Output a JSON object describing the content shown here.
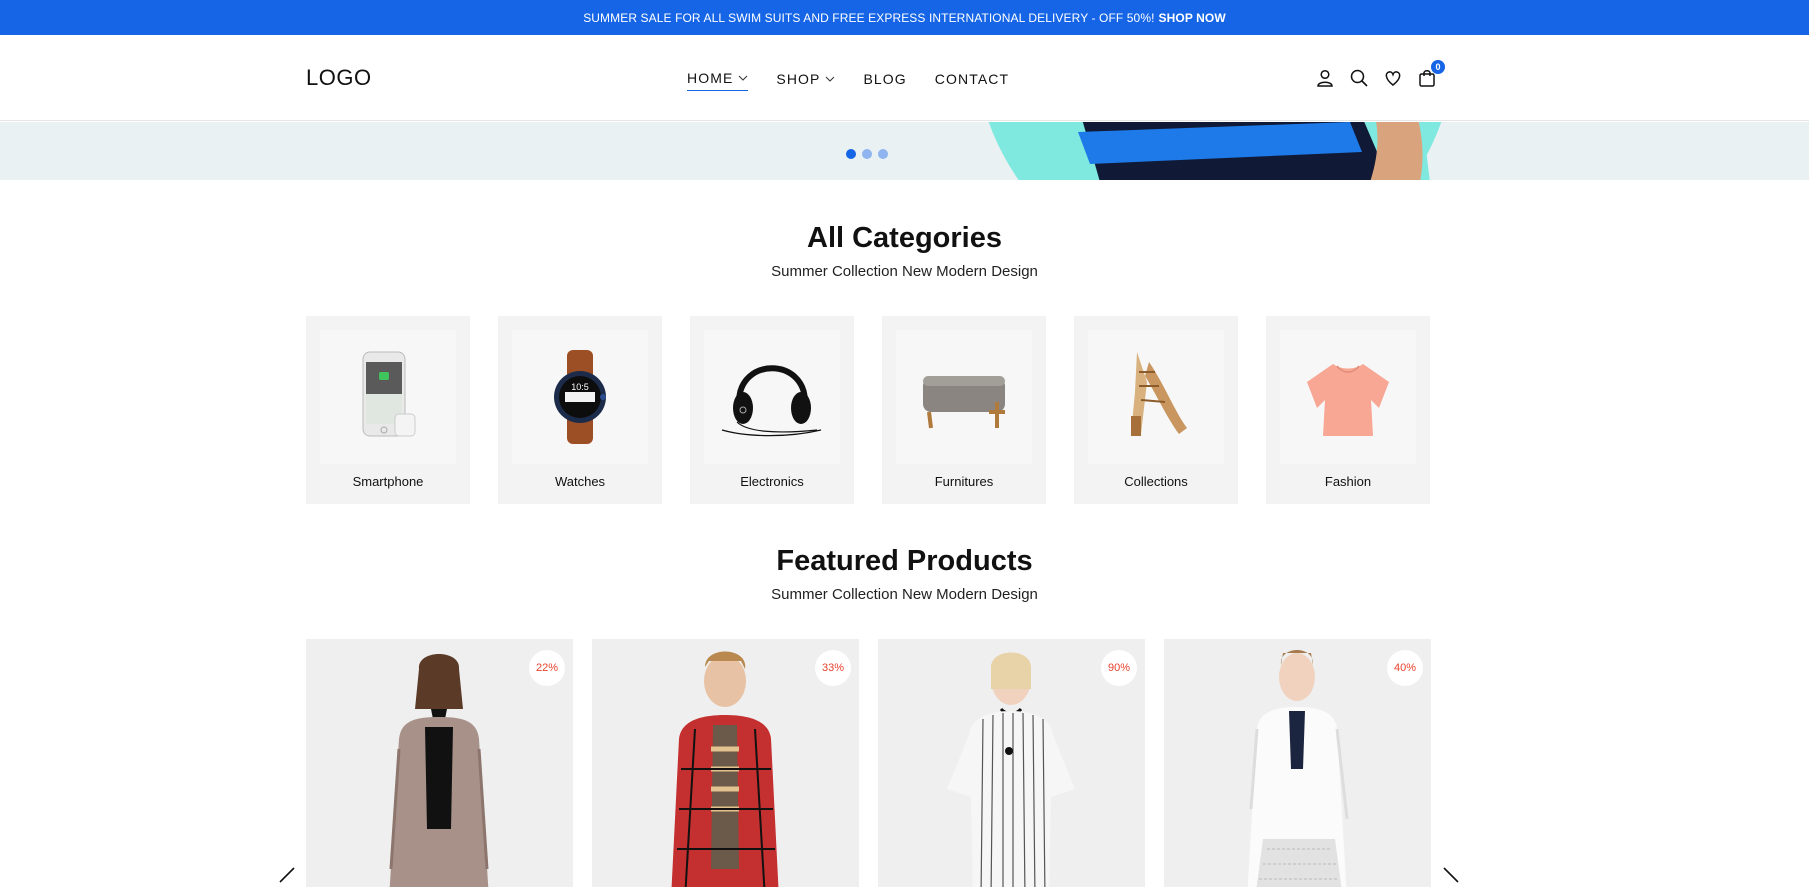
{
  "topbar": {
    "message": "SUMMER SALE FOR ALL SWIM SUITS AND FREE EXPRESS INTERNATIONAL DELIVERY - OFF 50%!",
    "cta": "SHOP NOW"
  },
  "header": {
    "logo": "LOGO",
    "nav": [
      {
        "label": "HOME",
        "active": true,
        "dropdown": true
      },
      {
        "label": "SHOP",
        "active": false,
        "dropdown": true
      },
      {
        "label": "BLOG",
        "active": false,
        "dropdown": false
      },
      {
        "label": "CONTACT",
        "active": false,
        "dropdown": false
      }
    ],
    "icons": [
      "user-icon",
      "search-icon",
      "heart-icon",
      "cart-icon"
    ],
    "cart_count": "0"
  },
  "hero": {
    "slides": 3,
    "active_slide": 1
  },
  "categories": {
    "title": "All Categories",
    "subtitle": "Summer Collection New Modern Design",
    "items": [
      {
        "label": "Smartphone",
        "icon": "smartphone-image"
      },
      {
        "label": "Watches",
        "icon": "watch-image"
      },
      {
        "label": "Electronics",
        "icon": "headphones-image"
      },
      {
        "label": "Furnitures",
        "icon": "ottoman-image"
      },
      {
        "label": "Collections",
        "icon": "sandals-image"
      },
      {
        "label": "Fashion",
        "icon": "blouse-image"
      }
    ]
  },
  "featured": {
    "title": "Featured Products",
    "subtitle": "Summer Collection New Modern Design",
    "products": [
      {
        "discount": "22%",
        "image": "woman-plaid-coat"
      },
      {
        "discount": "33%",
        "image": "man-red-flannel"
      },
      {
        "discount": "90%",
        "image": "woman-striped-dress"
      },
      {
        "discount": "40%",
        "image": "woman-white-lace-coat"
      }
    ]
  },
  "colors": {
    "accent": "#1565e6",
    "discount": "#e8412c",
    "card_bg": "#f3f3f3"
  }
}
